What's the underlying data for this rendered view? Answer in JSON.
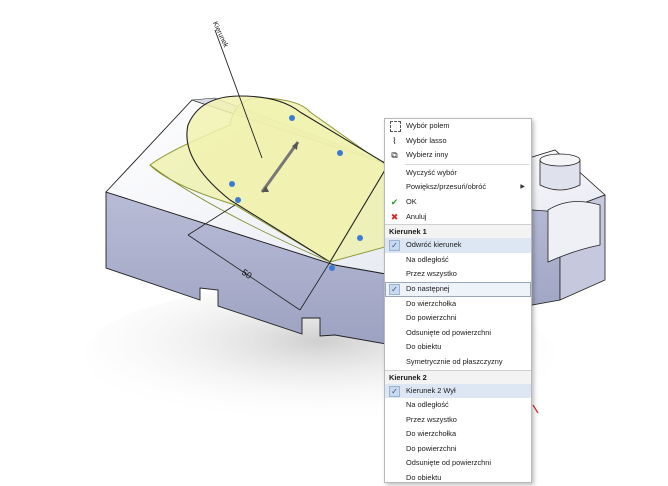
{
  "viewport": {
    "dimension_label": "50",
    "direction_label": "Kierunek"
  },
  "menu": {
    "top_items": [
      {
        "label": "Wybór polem",
        "icon": "box-select-icon"
      },
      {
        "label": "Wybór lasso",
        "icon": "lasso-icon"
      },
      {
        "label": "Wybierz inny",
        "icon": "select-other-icon"
      }
    ],
    "clear_selection": "Wyczyść wybór",
    "zoom_pan_rotate": "Powiększ/przesuń/obróć",
    "ok": "OK",
    "cancel": "Anuluj",
    "direction1": {
      "header": "Kierunek 1",
      "items": [
        {
          "label": "Odwróć kierunek",
          "checked": true,
          "highlighted": false
        },
        {
          "label": "Na odległość",
          "checked": false,
          "highlighted": false
        },
        {
          "label": "Przez wszystko",
          "checked": false,
          "highlighted": false
        },
        {
          "label": "Do następnej",
          "checked": true,
          "highlighted": true
        },
        {
          "label": "Do wierzchołka",
          "checked": false,
          "highlighted": false
        },
        {
          "label": "Do powierzchni",
          "checked": false,
          "highlighted": false
        },
        {
          "label": "Odsunięte od powierzchni",
          "checked": false,
          "highlighted": false
        },
        {
          "label": "Do obiektu",
          "checked": false,
          "highlighted": false
        },
        {
          "label": "Symetrycznie od płaszczyzny",
          "checked": false,
          "highlighted": false
        }
      ]
    },
    "direction2": {
      "header": "Kierunek 2",
      "items": [
        {
          "label": "Kierunek 2 Wył",
          "checked": true
        },
        {
          "label": "Na odległość",
          "checked": false
        },
        {
          "label": "Przez wszystko",
          "checked": false
        },
        {
          "label": "Do wierzchołka",
          "checked": false
        },
        {
          "label": "Do powierzchni",
          "checked": false
        },
        {
          "label": "Odsunięte od powierzchni",
          "checked": false
        },
        {
          "label": "Do obiektu",
          "checked": false
        }
      ]
    }
  },
  "colors": {
    "face_top": "#f2f3f8",
    "face_side": "#a9aecc",
    "sketch_fill": "#eef0a6",
    "ok_green": "#2e9a2e",
    "cancel_red": "#d22b2b"
  }
}
